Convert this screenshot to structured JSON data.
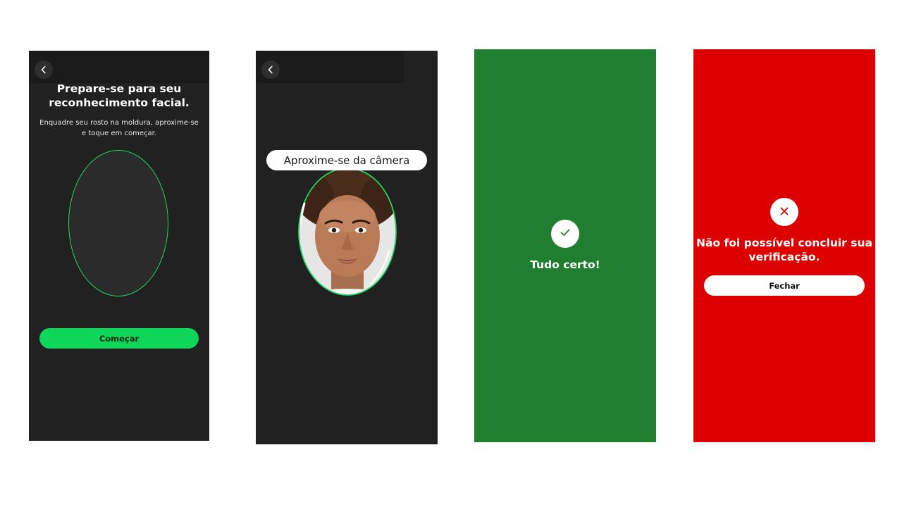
{
  "screen_prepare": {
    "title_line1": "Prepare-se para seu",
    "title_line2": "reconhecimento facial.",
    "subtitle_line1": "Enquadre seu rosto na moldura, aproxime-se",
    "subtitle_line2": "e toque em começar.",
    "start_button": "Começar",
    "back_icon": "chevron-left-icon",
    "frame_color": "#1ed760",
    "button_color": "#0dd65a",
    "background": "#212121"
  },
  "screen_capture": {
    "hint": "Aproxime-se da câmera",
    "back_icon": "chevron-left-icon",
    "frame_color": "#1ed760",
    "background": "#212121"
  },
  "screen_success": {
    "message": "Tudo certo!",
    "icon": "checkmark-icon",
    "background": "#1f7e2f"
  },
  "screen_error": {
    "message_line1": "Não foi possível concluir sua",
    "message_line2": "verificação.",
    "close_button": "Fechar",
    "icon": "close-icon",
    "background": "#dd0000"
  }
}
